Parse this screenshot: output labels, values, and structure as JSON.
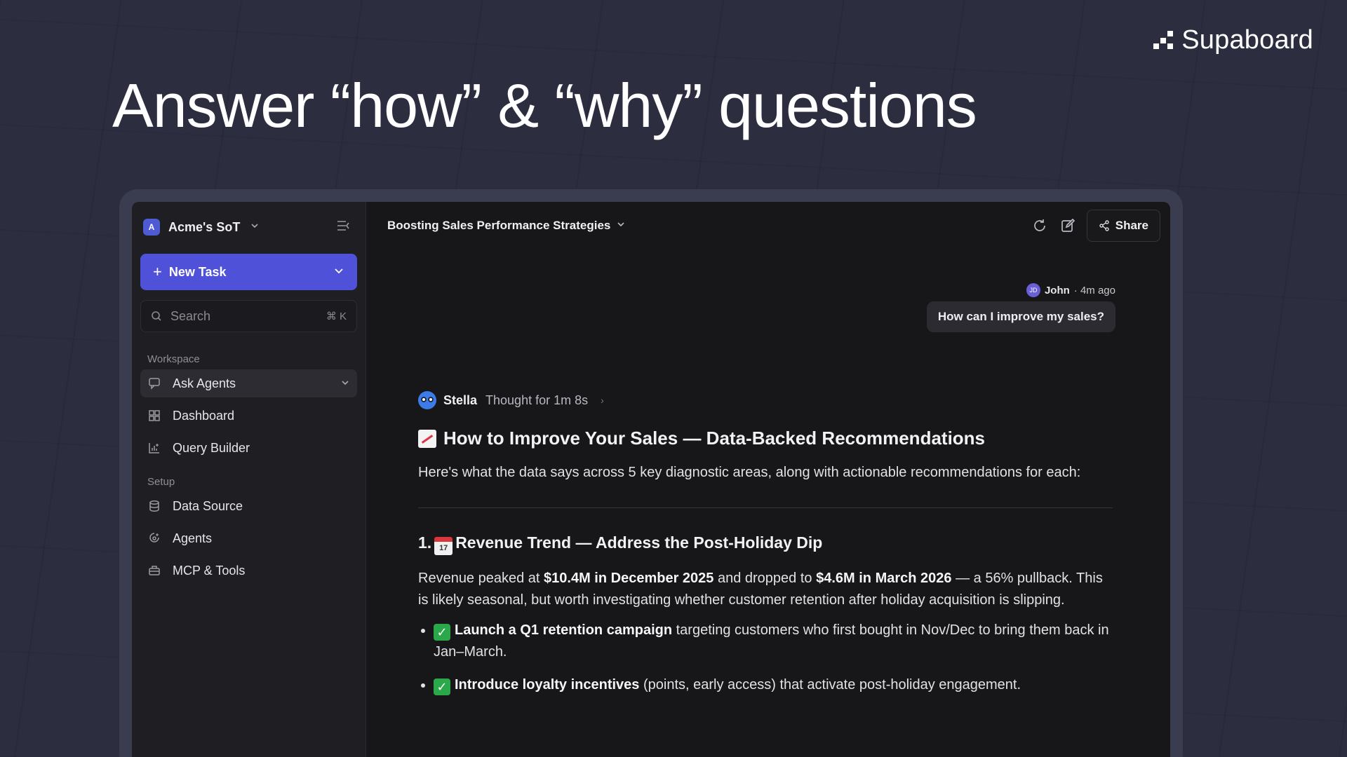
{
  "brand": {
    "name": "Supaboard"
  },
  "headline": "Answer “how” & “why” questions",
  "sidebar": {
    "workspace_initial": "A",
    "workspace_name": "Acme's SoT",
    "new_task_label": "New Task",
    "search_placeholder": "Search",
    "search_shortcut": "⌘ K",
    "section_workspace": "Workspace",
    "section_setup": "Setup",
    "items": [
      {
        "label": "Ask Agents",
        "icon": "chat-icon"
      },
      {
        "label": "Dashboard",
        "icon": "dashboard-icon"
      },
      {
        "label": "Query Builder",
        "icon": "chart-icon"
      },
      {
        "label": "Data Source",
        "icon": "database-icon"
      },
      {
        "label": "Agents",
        "icon": "agent-icon"
      },
      {
        "label": "MCP & Tools",
        "icon": "toolbox-icon"
      }
    ]
  },
  "topbar": {
    "title": "Boosting Sales Performance Strategies",
    "share_label": "Share"
  },
  "user_message": {
    "author": "John",
    "time": "· 4m ago",
    "text": "How can I improve my sales?"
  },
  "answer": {
    "agent_name": "Stella",
    "thought": "Thought for 1m 8s",
    "heading": "How to Improve Your Sales — Data-Backed Recommendations",
    "intro": "Here's what the data says across 5 key diagnostic areas, along with actionable recommendations for each:",
    "section1_number": "1.",
    "section1_title": "Revenue Trend — Address the Post-Holiday Dip",
    "p1_a": "Revenue peaked at ",
    "p1_b": "$10.4M in December 2025",
    "p1_c": " and dropped to ",
    "p1_d": "$4.6M in March 2026",
    "p1_e": " — a 56% pullback. This is likely seasonal, but worth investigating whether customer retention after holiday acquisition is slipping.",
    "bullet1_bold": "Launch a Q1 retention campaign",
    "bullet1_rest": " targeting customers who first bought in Nov/Dec to bring them back in Jan–March.",
    "bullet2_bold": "Introduce loyalty incentives",
    "bullet2_rest": " (points, early access) that activate post-holiday engagement.",
    "calendar_day": "17"
  }
}
